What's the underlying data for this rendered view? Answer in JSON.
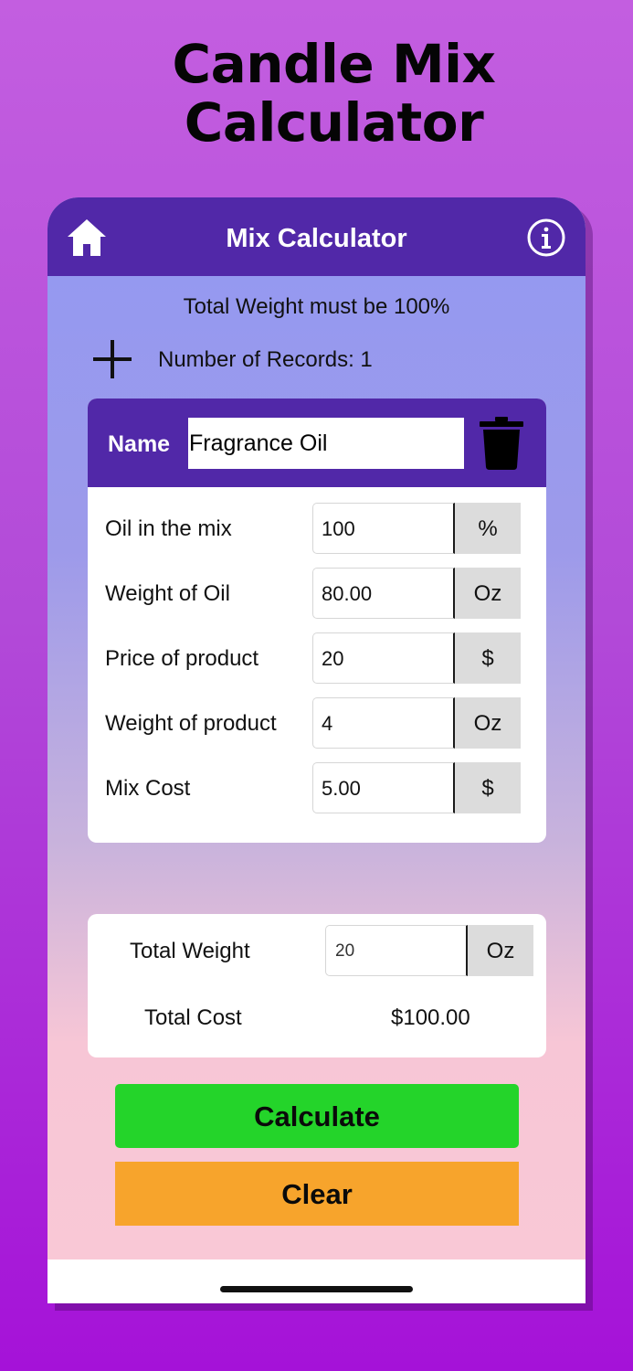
{
  "promo": {
    "title_line1": "Candle Mix",
    "title_line2": "Calculator"
  },
  "navbar": {
    "title": "Mix Calculator",
    "home_icon": "home-icon",
    "info_icon": "info-icon"
  },
  "notice": "Total Weight must be 100%",
  "records": {
    "label": "Number of Records: 1",
    "add_icon": "plus-icon"
  },
  "record": {
    "name_label": "Name",
    "name_value": "Fragrance Oil",
    "delete_icon": "trash-icon",
    "fields": [
      {
        "label": "Oil in the mix",
        "value": "100",
        "unit": "%"
      },
      {
        "label": "Weight of Oil",
        "value": "80.00",
        "unit": "Oz"
      },
      {
        "label": "Price of product",
        "value": "20",
        "unit": "$"
      },
      {
        "label": "Weight of product",
        "value": "4",
        "unit": "Oz"
      },
      {
        "label": "Mix Cost",
        "value": "5.00",
        "unit": "$"
      }
    ]
  },
  "totals": {
    "weight_label": "Total Weight",
    "weight_value": "20",
    "weight_unit": "Oz",
    "cost_label": "Total Cost",
    "cost_value": "$100.00"
  },
  "actions": {
    "calculate": "Calculate",
    "clear": "Clear"
  },
  "colors": {
    "nav": "#5128a8",
    "calculate": "#24d42a",
    "clear": "#f7a42c",
    "background": "#b24ad8"
  }
}
